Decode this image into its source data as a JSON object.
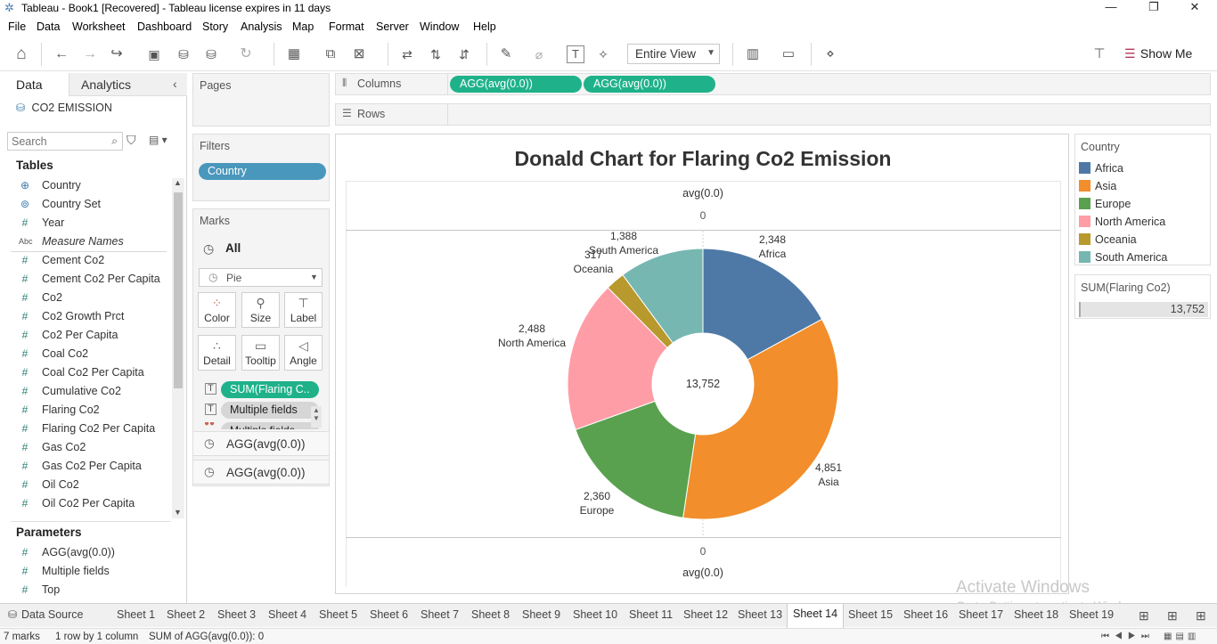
{
  "window": {
    "title": "Tableau - Book1 [Recovered] - Tableau license expires in 11 days",
    "minimize": "—",
    "restore": "❐",
    "close": "✕"
  },
  "menu": [
    "File",
    "Data",
    "Worksheet",
    "Dashboard",
    "Story",
    "Analysis",
    "Map",
    "Format",
    "Server",
    "Window",
    "Help"
  ],
  "toolbar": {
    "fit_value": "Entire View",
    "show_me_label": "Show Me",
    "icons": [
      "home-icon",
      "undo-icon",
      "redo-icon",
      "replay-icon",
      "save-icon",
      "new-data-source-icon",
      "pause-update-icon",
      "refresh-icon",
      "new-worksheet-icon",
      "duplicate-sheet-icon",
      "clear-sheet-icon",
      "swap-icon",
      "sort-ascending-icon",
      "sort-descending-icon",
      "highlight-icon",
      "group-icon",
      "label-icon",
      "pin-icon",
      "show-cards-icon",
      "presentation-icon",
      "share-icon",
      "format-painter-icon"
    ]
  },
  "left_pane": {
    "tab_data": "Data",
    "tab_analytics": "Analytics",
    "data_source": "CO2 EMISSION",
    "search_placeholder": "Search",
    "tables_header": "Tables",
    "fields": [
      {
        "type": "geo",
        "label": "Country",
        "italic": false
      },
      {
        "type": "set",
        "label": "Country Set",
        "italic": false
      },
      {
        "type": "num",
        "label": "Year",
        "italic": false
      },
      {
        "type": "abc",
        "label": "Measure Names",
        "italic": true
      },
      {
        "type": "num",
        "label": "Cement Co2",
        "italic": false
      },
      {
        "type": "num",
        "label": "Cement Co2 Per Capita",
        "italic": false
      },
      {
        "type": "num",
        "label": "Co2",
        "italic": false
      },
      {
        "type": "num",
        "label": "Co2 Growth Prct",
        "italic": false
      },
      {
        "type": "num",
        "label": "Co2 Per Capita",
        "italic": false
      },
      {
        "type": "num",
        "label": "Coal Co2",
        "italic": false
      },
      {
        "type": "num",
        "label": "Coal Co2 Per Capita",
        "italic": false
      },
      {
        "type": "num",
        "label": "Cumulative Co2",
        "italic": false
      },
      {
        "type": "num",
        "label": "Flaring Co2",
        "italic": false
      },
      {
        "type": "num",
        "label": "Flaring Co2 Per Capita",
        "italic": false
      },
      {
        "type": "num",
        "label": "Gas Co2",
        "italic": false
      },
      {
        "type": "num",
        "label": "Gas Co2 Per Capita",
        "italic": false
      },
      {
        "type": "num",
        "label": "Oil Co2",
        "italic": false
      },
      {
        "type": "num",
        "label": "Oil Co2 Per Capita",
        "italic": false
      }
    ],
    "parameters_header": "Parameters",
    "parameters": [
      {
        "type": "num",
        "label": "AGG(avg(0.0))"
      },
      {
        "type": "num",
        "label": "Multiple fields"
      },
      {
        "type": "num",
        "label": "Top"
      }
    ]
  },
  "cards": {
    "pages_label": "Pages",
    "filters_label": "Filters",
    "filter_pill": "Country",
    "marks_label": "Marks",
    "marks_all": "All",
    "mark_type": "Pie",
    "mark_buttons": [
      {
        "label": "Color",
        "icon": "color-icon"
      },
      {
        "label": "Size",
        "icon": "size-icon"
      },
      {
        "label": "Label",
        "icon": "label-icon"
      },
      {
        "label": "Detail",
        "icon": "detail-icon"
      },
      {
        "label": "Tooltip",
        "icon": "tooltip-icon"
      },
      {
        "label": "Angle",
        "icon": "angle-icon"
      }
    ],
    "mark_pills": [
      "SUM(Flaring C..",
      "Multiple fields",
      "Multiple fields"
    ],
    "agg_rows": [
      "AGG(avg(0.0))",
      "AGG(avg(0.0))"
    ]
  },
  "shelves": {
    "columns_label": "Columns",
    "rows_label": "Rows",
    "column_pills": [
      "AGG(avg(0.0))",
      "AGG(avg(0.0))"
    ]
  },
  "viz": {
    "title": "Donald Chart for  Flaring Co2 Emission",
    "top_axis_title": "avg(0.0)",
    "top_axis_tick": "0",
    "bottom_axis_tick": "0",
    "bottom_axis_title": "avg(0.0)",
    "center_label": "13,752"
  },
  "chart_data": {
    "type": "pie",
    "title": "Donald Chart for  Flaring Co2 Emission",
    "donut": true,
    "center_total": "13,752",
    "categories": [
      "Africa",
      "Asia",
      "Europe",
      "North America",
      "Oceania",
      "South America"
    ],
    "values": [
      2348,
      4851,
      2360,
      2488,
      317,
      1388
    ],
    "value_labels": [
      "2,348",
      "4,851",
      "2,360",
      "2,488",
      "317",
      "1,388"
    ],
    "colors": [
      "#4e79a7",
      "#f28e2b",
      "#59a14f",
      "#ff9da7",
      "#b7992e",
      "#76b7b2"
    ]
  },
  "legend": {
    "title": "Country",
    "items": [
      {
        "label": "Africa",
        "color": "#4e79a7"
      },
      {
        "label": "Asia",
        "color": "#f28e2b"
      },
      {
        "label": "Europe",
        "color": "#59a14f"
      },
      {
        "label": "North America",
        "color": "#ff9da7"
      },
      {
        "label": "Oceania",
        "color": "#b7992e"
      },
      {
        "label": "South America",
        "color": "#76b7b2"
      }
    ],
    "size_title": "SUM(Flaring Co2)",
    "size_value": "13,752"
  },
  "sheet_tabs": {
    "data_source": "Data Source",
    "sheets": [
      "Sheet 1",
      "Sheet 2",
      "Sheet 3",
      "Sheet 4",
      "Sheet 5",
      "Sheet 6",
      "Sheet 7",
      "Sheet 8",
      "Sheet 9",
      "Sheet 10",
      "Sheet 11",
      "Sheet 12",
      "Sheet 13",
      "Sheet 14",
      "Sheet 15",
      "Sheet 16",
      "Sheet 17",
      "Sheet 18",
      "Sheet 19"
    ],
    "active": "Sheet 14"
  },
  "status": {
    "marks": "7 marks",
    "rows_cols": "1 row by 1 column",
    "sum": "SUM of AGG(avg(0.0)): 0"
  },
  "watermark": {
    "line1": "Activate Windows",
    "line2": "Go to Settings to activate Windows."
  }
}
